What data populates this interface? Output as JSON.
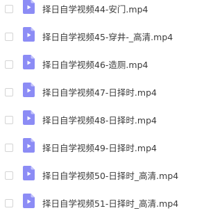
{
  "files": [
    {
      "name": "择日自学视频44-安门.mp4",
      "icon": "video-file-icon"
    },
    {
      "name": "择日自学视频45-穿井-_高清.mp4",
      "icon": "video-file-icon"
    },
    {
      "name": "择日自学视频46-造厕.mp4",
      "icon": "video-file-icon"
    },
    {
      "name": "择日自学视频47-日择时.mp4",
      "icon": "video-file-icon"
    },
    {
      "name": "择日自学视频48-日择时.mp4",
      "icon": "video-file-icon"
    },
    {
      "name": "择日自学视频49-日择时.mp4",
      "icon": "video-file-icon"
    },
    {
      "name": "择日自学视频50-日择时_高清.mp4",
      "icon": "video-file-icon"
    },
    {
      "name": "择日自学视频51-日择时_高清.mp4",
      "icon": "video-file-icon"
    }
  ],
  "colors": {
    "icon_fill": "#8c8cf5",
    "icon_fold": "#c6c6fb",
    "text": "#3b3b3b",
    "checkbox_border": "#d4d4d4"
  }
}
